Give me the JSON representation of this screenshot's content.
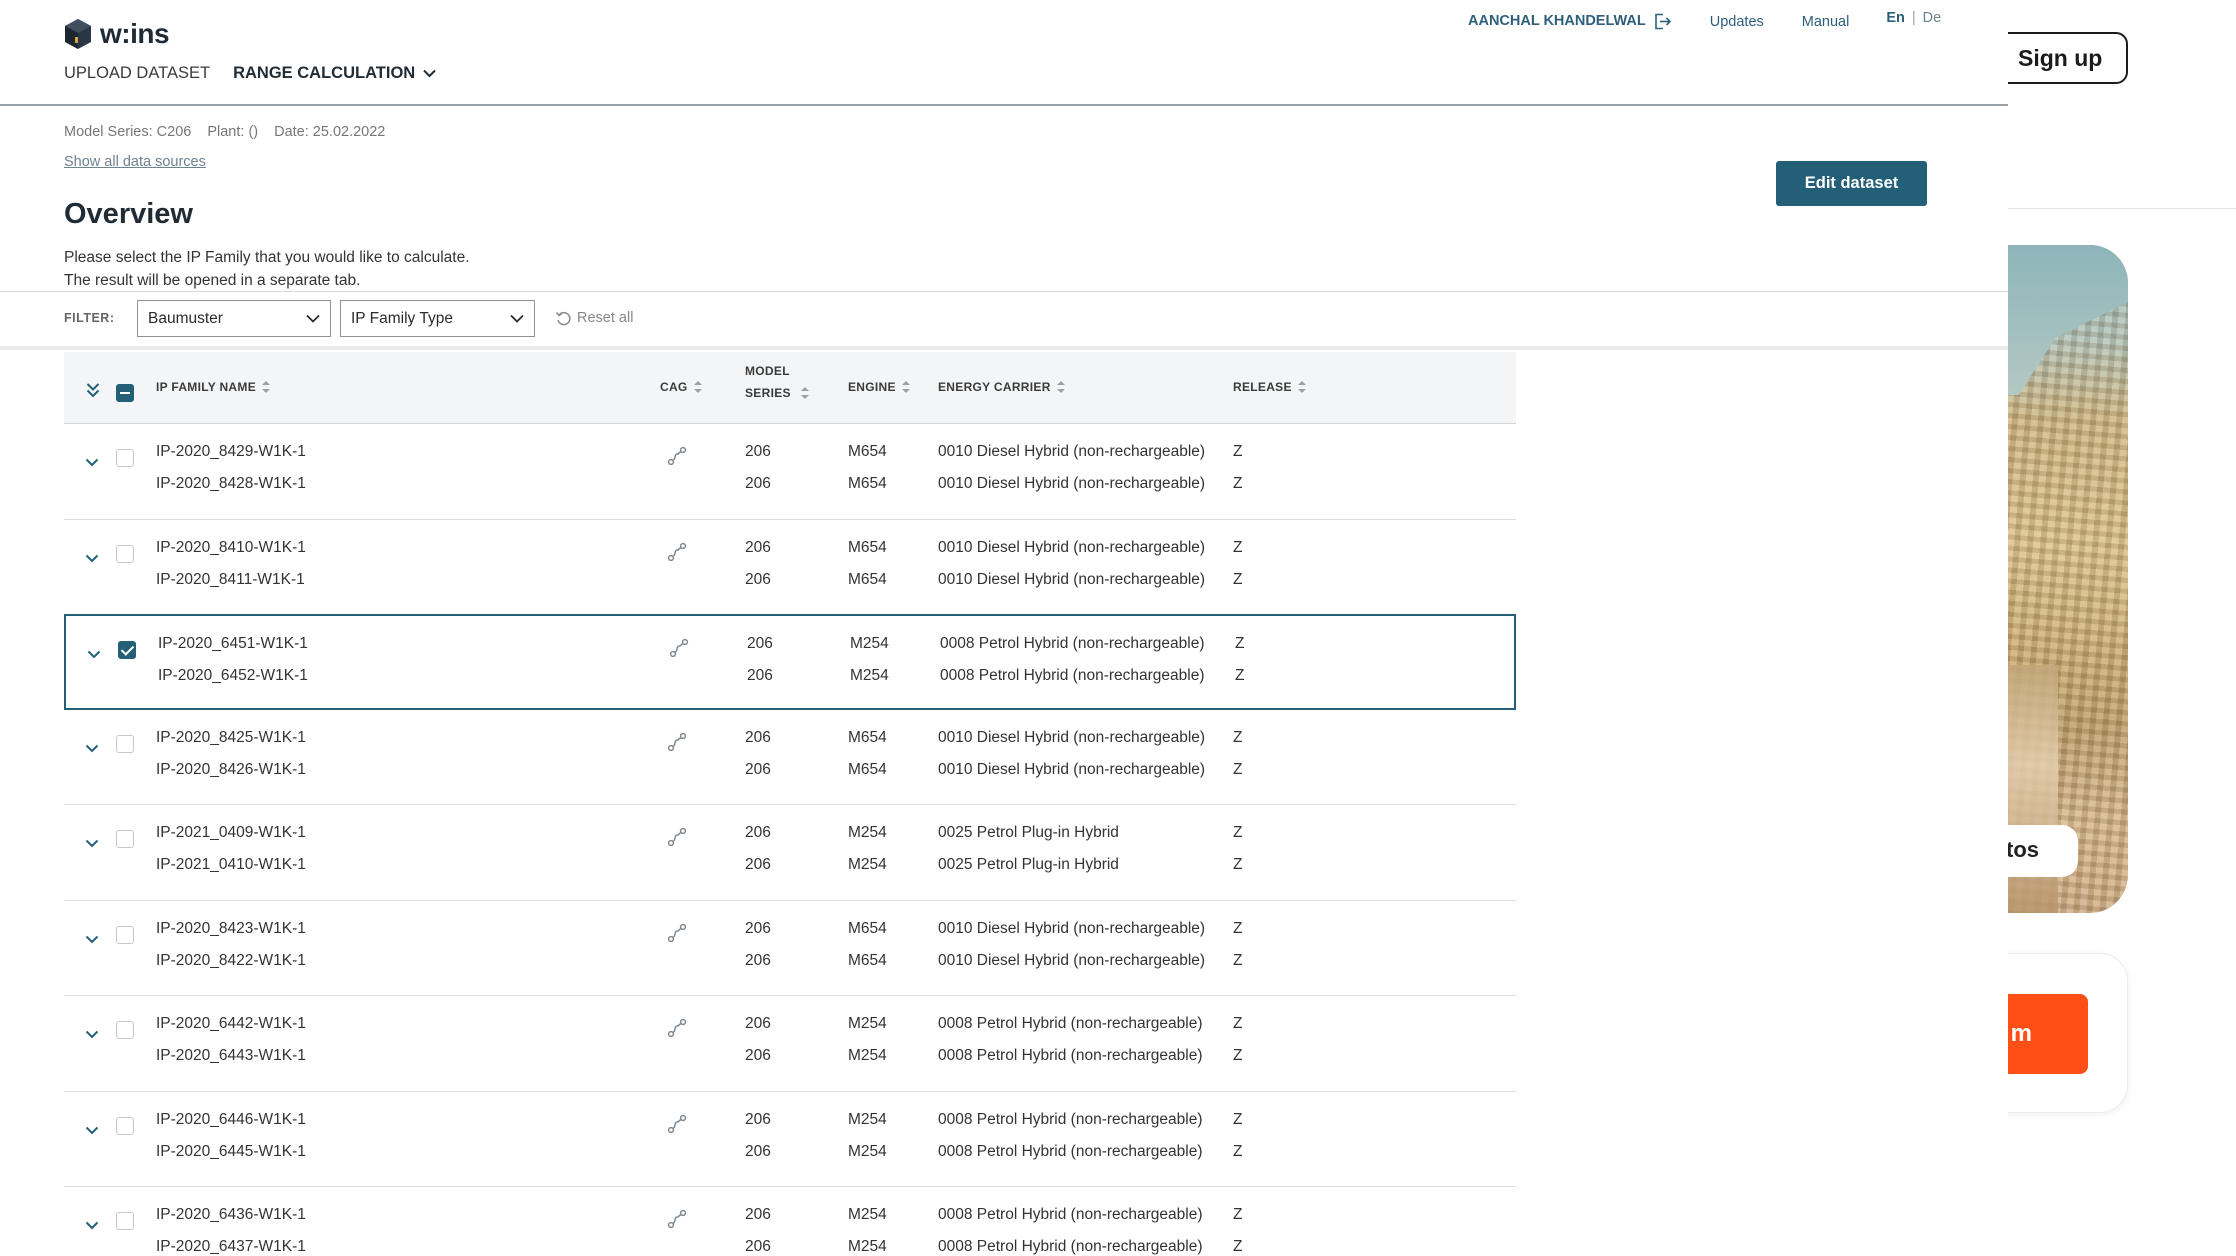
{
  "app": {
    "logo_text": "w:ins",
    "nav": {
      "upload_dataset": "UPLOAD DATASET",
      "range_calculation": "RANGE CALCULATION"
    },
    "user": {
      "name": "AANCHAL KHANDELWAL",
      "updates": "Updates",
      "manual": "Manual",
      "lang_selected": "En",
      "lang_separator": "|",
      "lang_other": "De"
    },
    "meta": {
      "model_series": "Model Series: C206",
      "plant": "Plant: ()",
      "date": "Date: 25.02.2022",
      "show_sources": "Show all data sources"
    },
    "edit_dataset": "Edit dataset",
    "title": "Overview",
    "description": [
      "Please select the IP Family that you would like to calculate.",
      "The result will be opened in a separate tab."
    ],
    "filter": {
      "label": "FILTER:",
      "select1": "Baumuster",
      "select2": "IP Family Type",
      "reset": "Reset all"
    },
    "table": {
      "headers": {
        "ip_family_name": "IP FAMILY NAME",
        "cag": "CAG",
        "model_series_1": "MODEL",
        "model_series_2": "SERIES",
        "engine": "ENGINE",
        "energy_carrier": "ENERGY CARRIER",
        "release": "RELEASE"
      },
      "rows": [
        {
          "checked": false,
          "items": [
            {
              "name": "IP-2020_8429-W1K-1",
              "series": "206",
              "engine": "M654",
              "energy": "0010 Diesel Hybrid (non-rechargeable)",
              "release": "Z"
            },
            {
              "name": "IP-2020_8428-W1K-1",
              "series": "206",
              "engine": "M654",
              "energy": "0010 Diesel Hybrid (non-rechargeable)",
              "release": "Z"
            }
          ]
        },
        {
          "checked": false,
          "items": [
            {
              "name": "IP-2020_8410-W1K-1",
              "series": "206",
              "engine": "M654",
              "energy": "0010 Diesel Hybrid (non-rechargeable)",
              "release": "Z"
            },
            {
              "name": "IP-2020_8411-W1K-1",
              "series": "206",
              "engine": "M654",
              "energy": "0010 Diesel Hybrid (non-rechargeable)",
              "release": "Z"
            }
          ]
        },
        {
          "checked": true,
          "items": [
            {
              "name": "IP-2020_6451-W1K-1",
              "series": "206",
              "engine": "M254",
              "energy": "0008 Petrol Hybrid (non-rechargeable)",
              "release": "Z"
            },
            {
              "name": "IP-2020_6452-W1K-1",
              "series": "206",
              "engine": "M254",
              "energy": "0008 Petrol Hybrid (non-rechargeable)",
              "release": "Z"
            }
          ]
        },
        {
          "checked": false,
          "items": [
            {
              "name": "IP-2020_8425-W1K-1",
              "series": "206",
              "engine": "M654",
              "energy": "0010 Diesel Hybrid (non-rechargeable)",
              "release": "Z"
            },
            {
              "name": "IP-2020_8426-W1K-1",
              "series": "206",
              "engine": "M654",
              "energy": "0010 Diesel Hybrid (non-rechargeable)",
              "release": "Z"
            }
          ]
        },
        {
          "checked": false,
          "items": [
            {
              "name": "IP-2021_0409-W1K-1",
              "series": "206",
              "engine": "M254",
              "energy": "0025 Petrol Plug-in Hybrid",
              "release": "Z"
            },
            {
              "name": "IP-2021_0410-W1K-1",
              "series": "206",
              "engine": "M254",
              "energy": "0025 Petrol Plug-in Hybrid",
              "release": "Z"
            }
          ]
        },
        {
          "checked": false,
          "items": [
            {
              "name": "IP-2020_8423-W1K-1",
              "series": "206",
              "engine": "M654",
              "energy": "0010 Diesel Hybrid (non-rechargeable)",
              "release": "Z"
            },
            {
              "name": "IP-2020_8422-W1K-1",
              "series": "206",
              "engine": "M654",
              "energy": "0010 Diesel Hybrid (non-rechargeable)",
              "release": "Z"
            }
          ]
        },
        {
          "checked": false,
          "items": [
            {
              "name": "IP-2020_6442-W1K-1",
              "series": "206",
              "engine": "M254",
              "energy": "0008 Petrol Hybrid (non-rechargeable)",
              "release": "Z"
            },
            {
              "name": "IP-2020_6443-W1K-1",
              "series": "206",
              "engine": "M254",
              "energy": "0008 Petrol Hybrid (non-rechargeable)",
              "release": "Z"
            }
          ]
        },
        {
          "checked": false,
          "items": [
            {
              "name": "IP-2020_6446-W1K-1",
              "series": "206",
              "engine": "M254",
              "energy": "0008 Petrol Hybrid (non-rechargeable)",
              "release": "Z"
            },
            {
              "name": "IP-2020_6445-W1K-1",
              "series": "206",
              "engine": "M254",
              "energy": "0008 Petrol Hybrid (non-rechargeable)",
              "release": "Z"
            }
          ]
        },
        {
          "checked": false,
          "items": [
            {
              "name": "IP-2020_6436-W1K-1",
              "series": "206",
              "engine": "M254",
              "energy": "0008 Petrol Hybrid (non-rechargeable)",
              "release": "Z"
            },
            {
              "name": "IP-2020_6437-W1K-1",
              "series": "206",
              "engine": "M254",
              "energy": "0008 Petrol Hybrid (non-rechargeable)",
              "release": "Z"
            }
          ]
        }
      ]
    }
  },
  "side": {
    "signup": "Sign up",
    "photo_label": "tos",
    "cta_label": "m"
  },
  "colors": {
    "accent": "#245f78",
    "cta": "#ff4f17",
    "link": "#2c5f7b"
  },
  "icons": {
    "logo": "cube-logo-icon",
    "logout": "logout-icon",
    "dropdown": "chevron-down-icon",
    "reset": "reset-icon",
    "expand_all": "double-chevron-down-icon",
    "row_toggle": "chevron-down-icon",
    "cag": "link-icon",
    "sort": "sort-icon"
  }
}
